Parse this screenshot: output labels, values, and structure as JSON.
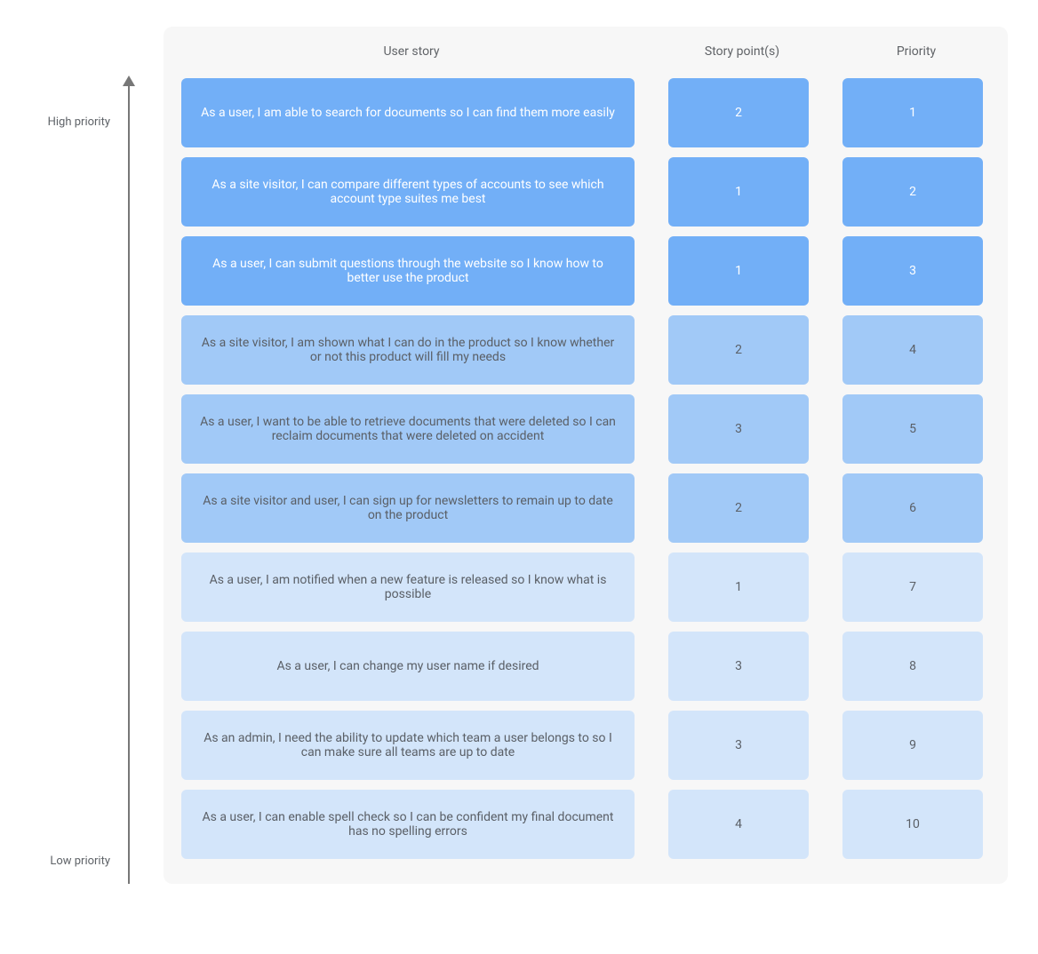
{
  "axis": {
    "high_label": "High priority",
    "low_label": "Low priority"
  },
  "headers": {
    "story": "User story",
    "points": "Story point(s)",
    "priority": "Priority"
  },
  "rows": [
    {
      "story": "As a user, I am able to search for documents so I can find them more easily",
      "points": "2",
      "priority": "1",
      "tier": "high"
    },
    {
      "story": "As a site visitor, I can compare different types of accounts to see which account type suites me best",
      "points": "1",
      "priority": "2",
      "tier": "high"
    },
    {
      "story": "As a user, I can submit questions through the website so I know how to better use the product",
      "points": "1",
      "priority": "3",
      "tier": "high"
    },
    {
      "story": "As a site visitor, I am shown what I can do in the product so I know whether or not this product will fill my needs",
      "points": "2",
      "priority": "4",
      "tier": "mid"
    },
    {
      "story": "As a user, I want to be able to retrieve documents that were deleted so I can reclaim documents that were deleted on accident",
      "points": "3",
      "priority": "5",
      "tier": "mid"
    },
    {
      "story": "As a site visitor and user, I can sign up for newsletters to remain up to date on the product",
      "points": "2",
      "priority": "6",
      "tier": "mid"
    },
    {
      "story": "As a user, I am notified when a new feature is released so I know what is possible",
      "points": "1",
      "priority": "7",
      "tier": "low"
    },
    {
      "story": "As a user, I can change my user name if desired",
      "points": "3",
      "priority": "8",
      "tier": "low"
    },
    {
      "story": "As an admin, I need the ability to update which team a user belongs to so I can make sure all teams are up to date",
      "points": "3",
      "priority": "9",
      "tier": "low"
    },
    {
      "story": "As a user, I can enable spell check so I can be confident my final document has no spelling errors",
      "points": "4",
      "priority": "10",
      "tier": "low"
    }
  ]
}
